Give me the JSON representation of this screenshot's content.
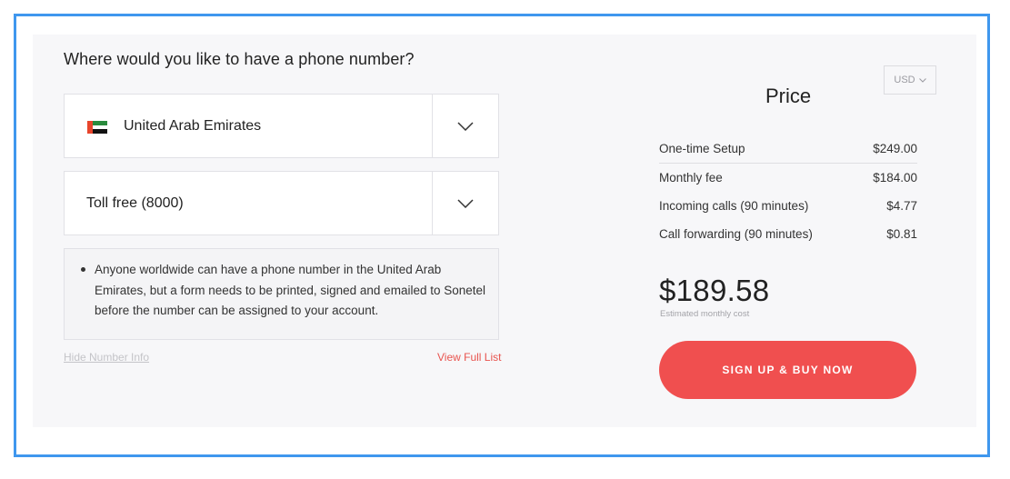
{
  "question": "Where would you like to have a phone number?",
  "country_select": {
    "selected": "United Arab Emirates",
    "flag": "uae-flag-icon",
    "flag_colors": [
      "#e8452c",
      "#2a8b3d",
      "#ffffff",
      "#111111"
    ]
  },
  "type_select": {
    "selected": "Toll free (8000)"
  },
  "info": {
    "text": "Anyone worldwide can have a phone number in the United Arab Emirates, but a form needs to be printed, signed and emailed to Sonetel before the number can be assigned to your account."
  },
  "links": {
    "hide_info": "Hide Number Info",
    "view_full_list": "View Full List"
  },
  "currency": {
    "selected": "USD"
  },
  "price": {
    "title": "Price",
    "rows": [
      {
        "label": "One-time Setup",
        "value": "$249.00"
      },
      {
        "label": "Monthly fee",
        "value": "$184.00"
      },
      {
        "label": "Incoming calls (90 minutes)",
        "value": "$4.77"
      },
      {
        "label": "Call forwarding (90 minutes)",
        "value": "$0.81"
      }
    ],
    "total": "$189.58",
    "total_label": "Estimated monthly cost"
  },
  "cta": {
    "label": "SIGN UP & BUY NOW",
    "color": "#f04f4f"
  },
  "colors": {
    "frame_border": "#3f97ee",
    "panel_bg": "#f7f7f9",
    "link_accent": "#e8544f"
  }
}
